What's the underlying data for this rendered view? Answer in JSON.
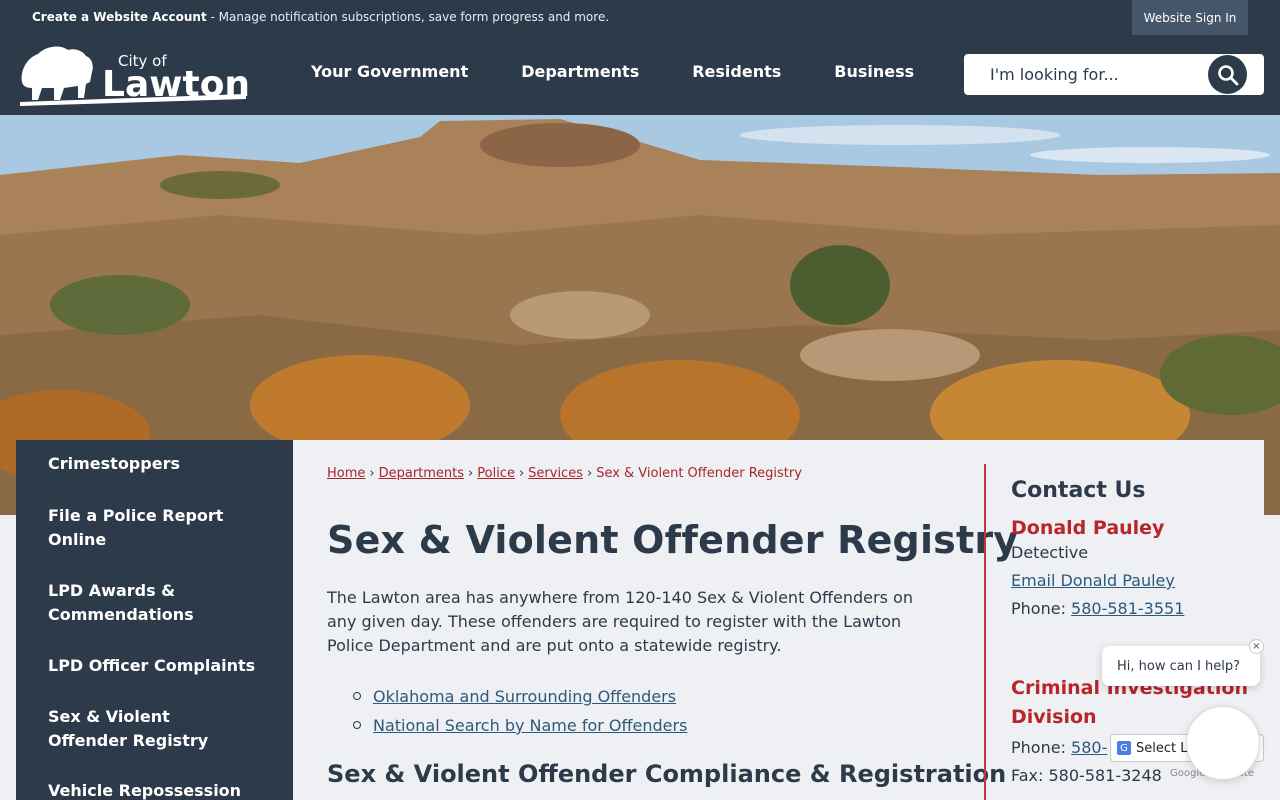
{
  "topbar": {
    "create_account_bold": "Create a Website Account",
    "create_account_rest": " - Manage notification subscriptions, save form progress and more.",
    "signin_label": "Website Sign In"
  },
  "header": {
    "logo_text_top": "City of",
    "logo_text_main": "Lawton",
    "nav": [
      "Your Government",
      "Departments",
      "Residents",
      "Business"
    ],
    "search_placeholder": "I'm looking for..."
  },
  "sidebar": {
    "items": [
      "Crimestoppers",
      "File a Police Report Online",
      "LPD Awards & Commendations",
      "LPD Officer Complaints",
      "Sex & Violent Offender Registry",
      "Vehicle Repossession"
    ]
  },
  "main": {
    "breadcrumb": [
      "Home",
      "Departments",
      "Police",
      "Services"
    ],
    "breadcrumb_current": "Sex & Violent Offender Registry",
    "breadcrumb_separator": "›",
    "title": "Sex & Violent Offender Registry",
    "intro": "The Lawton area has anywhere from 120-140 Sex & Violent Offenders on any given day. These offenders are required to register with the Lawton Police Department and are put onto a statewide registry.",
    "links": [
      "Oklahoma and Surrounding Offenders",
      "National Search by Name for Offenders"
    ],
    "section_heading": "Sex & Violent Offender Compliance & Registration"
  },
  "contact": {
    "heading": "Contact Us",
    "name": "Donald Pauley",
    "role": "Detective",
    "email_label": "Email Donald Pauley",
    "phone_label": "Phone:",
    "phone": "580-581-3551",
    "dept": "Criminal Investigation Division",
    "dept_phone_label": "Phone:",
    "dept_phone": "580-",
    "fax_label": "Fax:",
    "fax": "580-581-3248"
  },
  "widgets": {
    "chat_prompt": "Hi, how can I help?",
    "chat_close": "×",
    "translate_label": "Select La",
    "powered_by": "Google Translate"
  },
  "colors": {
    "navy": "#2c3a4a",
    "accent_red": "#b8262c",
    "link_blue": "#2c5a7a"
  }
}
